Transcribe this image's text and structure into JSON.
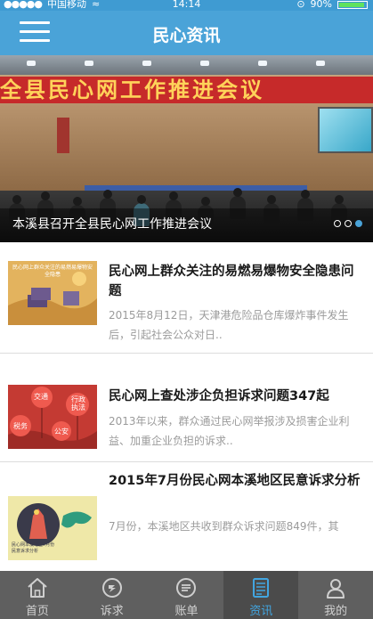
{
  "status_bar": {
    "carrier": "中国移动",
    "time": "14:14",
    "battery": "90%"
  },
  "header": {
    "title": "民心资讯"
  },
  "banner": {
    "backdrop_text": "全县民心网工作推进会议",
    "caption": "本溪县召开全县民心网工作推进会议",
    "pages": 3,
    "active_page": 3
  },
  "news": [
    {
      "title": "民心网上群众关注的易燃易爆物安全隐患问题",
      "summary": "2015年8月12日，天津港危险品仓库爆炸事件发生后，引起社会公众对日..",
      "thumb_label": "民心网上群众关注的易燃易爆物安全隐患"
    },
    {
      "title": "民心网上查处涉企负担诉求问题347起",
      "summary": "2013年以来，群众通过民心网举报涉及损害企业利益、加重企业负担的诉求..",
      "thumb_bubbles": [
        "交通",
        "行政执法",
        "税务",
        "公安"
      ]
    },
    {
      "title": "2015年7月份民心网本溪地区民意诉求分析",
      "summary": "7月份，本溪地区共收到群众诉求问题849件，其",
      "thumb_lines": [
        "民心网本溪地区7月份",
        "民意诉求分析"
      ]
    }
  ],
  "tabs": [
    {
      "label": "首页",
      "icon": "home-icon",
      "active": false
    },
    {
      "label": "诉求",
      "icon": "appeal-icon",
      "active": false
    },
    {
      "label": "账单",
      "icon": "bill-icon",
      "active": false
    },
    {
      "label": "资讯",
      "icon": "news-icon",
      "active": true
    },
    {
      "label": "我的",
      "icon": "user-icon",
      "active": false
    }
  ],
  "colors": {
    "header": "#4aa3d8",
    "tabbar": "#5f5f5f",
    "active_tab": "#42a5e0"
  }
}
